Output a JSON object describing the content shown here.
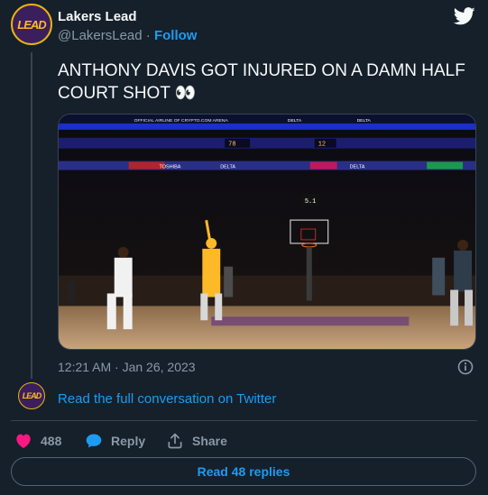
{
  "author": {
    "name": "Lakers Lead",
    "handle": "@LakersLead",
    "separator": "·",
    "follow_label": "Follow",
    "avatar_text": "LEAD"
  },
  "tweet": {
    "text": "ANTHONY DAVIS GOT INJURED ON A DAMN HALF COURT SHOT 👀",
    "timestamp": "12:21 AM · Jan 26, 2023"
  },
  "media": {
    "banner_top_left": "OFFICIAL AIRLINE OF CRYPTO.COM ARENA",
    "banner_delta": "DELTA",
    "shot_clock": "5.1",
    "scoreboard_left": "78",
    "scoreboard_right": "12",
    "ribbon_toshiba": "TOSHIBA",
    "ribbon_delta": "DELTA"
  },
  "conversation": {
    "link_label": "Read the full conversation on Twitter"
  },
  "actions": {
    "likes": "488",
    "reply_label": "Reply",
    "share_label": "Share"
  },
  "replies": {
    "button_label": "Read 48 replies"
  },
  "colors": {
    "background": "#15202b",
    "accent": "#1d9bf0",
    "like": "#f91880",
    "lakers_purple": "#552583",
    "lakers_gold": "#fdb927"
  }
}
